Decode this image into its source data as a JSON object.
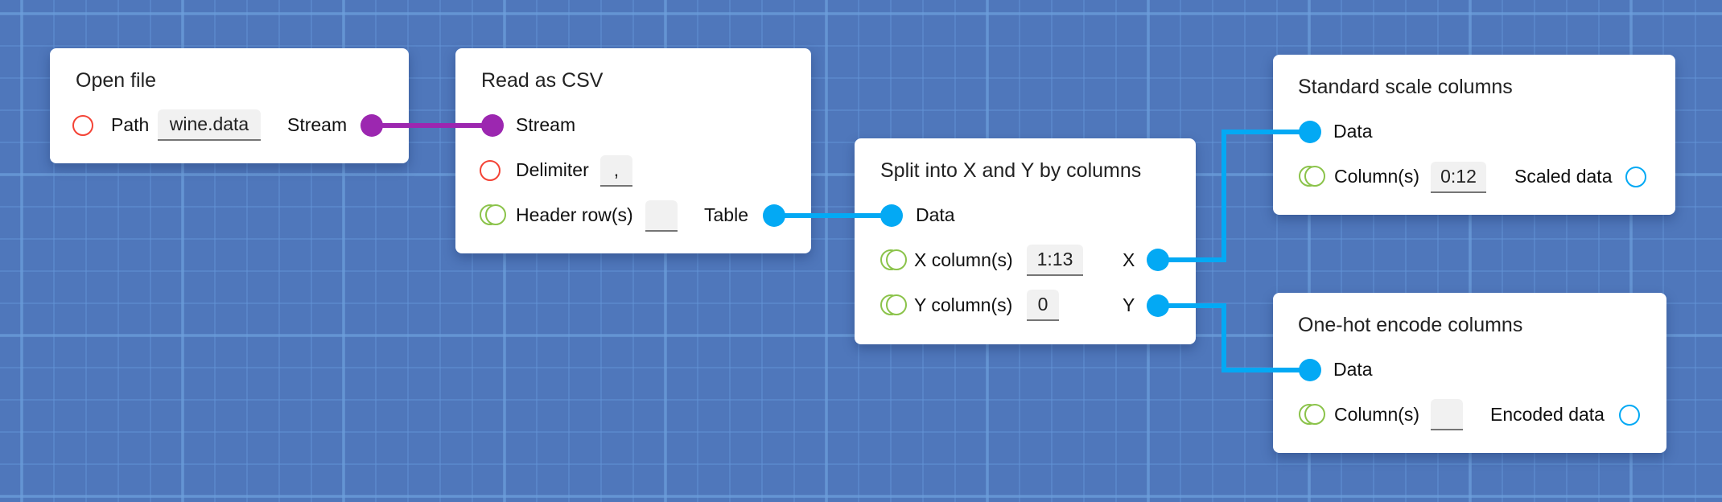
{
  "colors": {
    "background": "#4f77bb",
    "stream_wire": "#9c27b0",
    "data_wire": "#03a9f4",
    "required_input": "#f44336",
    "optional_input": "#8bc34a",
    "unconnected_output": "#03a9f4"
  },
  "nodes": {
    "open_file": {
      "title": "Open file",
      "inputs": [
        {
          "label": "Path",
          "value": "wine.data",
          "icon": "ring-red-icon"
        }
      ],
      "outputs": [
        {
          "label": "Stream",
          "icon": "pin-purple-icon"
        }
      ]
    },
    "read_csv": {
      "title": "Read as CSV",
      "inputs": [
        {
          "label": "Stream",
          "icon": "pin-purple-icon"
        },
        {
          "label": "Delimiter",
          "value": ",",
          "icon": "ring-red-icon"
        },
        {
          "label": "Header row(s)",
          "value": "",
          "icon": "double-ring-green-icon"
        }
      ],
      "outputs": [
        {
          "label": "Table",
          "icon": "pin-blue-icon"
        }
      ]
    },
    "split": {
      "title": "Split into X and Y by columns",
      "inputs": [
        {
          "label": "Data",
          "icon": "pin-blue-icon"
        },
        {
          "label": "X column(s)",
          "value": "1:13",
          "icon": "double-ring-green-icon"
        },
        {
          "label": "Y column(s)",
          "value": "0",
          "icon": "double-ring-green-icon"
        }
      ],
      "outputs": [
        {
          "label": "X",
          "icon": "pin-blue-icon"
        },
        {
          "label": "Y",
          "icon": "pin-blue-icon"
        }
      ]
    },
    "standard_scale": {
      "title": "Standard scale columns",
      "inputs": [
        {
          "label": "Data",
          "icon": "pin-blue-icon"
        },
        {
          "label": "Column(s)",
          "value": "0:12",
          "icon": "double-ring-green-icon"
        }
      ],
      "outputs": [
        {
          "label": "Scaled data",
          "icon": "ring-blue-icon"
        }
      ]
    },
    "one_hot": {
      "title": "One-hot encode columns",
      "inputs": [
        {
          "label": "Data",
          "icon": "pin-blue-icon"
        },
        {
          "label": "Column(s)",
          "value": "",
          "icon": "double-ring-green-icon"
        }
      ],
      "outputs": [
        {
          "label": "Encoded data",
          "icon": "ring-blue-icon"
        }
      ]
    }
  },
  "connections": [
    {
      "from": "Open file.Stream",
      "to": "Read as CSV.Stream",
      "type": "stream"
    },
    {
      "from": "Read as CSV.Table",
      "to": "Split into X and Y by columns.Data",
      "type": "data"
    },
    {
      "from": "Split into X and Y by columns.X",
      "to": "Standard scale columns.Data",
      "type": "data"
    },
    {
      "from": "Split into X and Y by columns.Y",
      "to": "One-hot encode columns.Data",
      "type": "data"
    }
  ]
}
